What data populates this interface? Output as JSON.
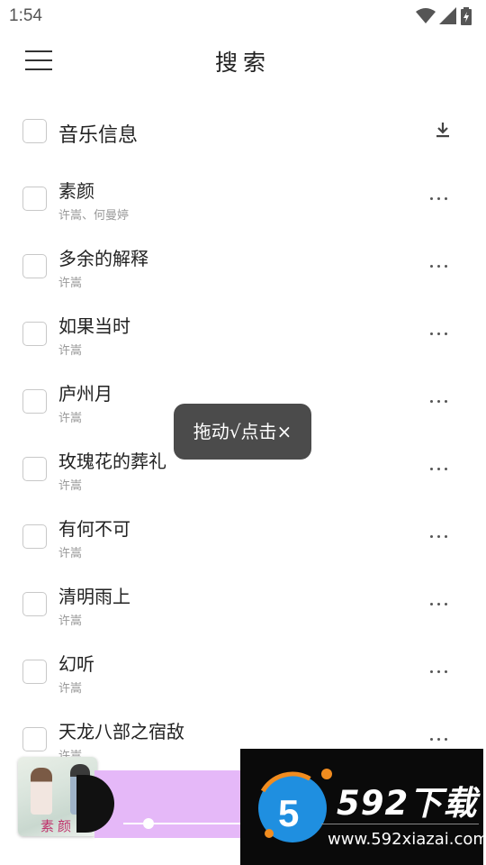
{
  "status_bar": {
    "time": "1:54",
    "icons": [
      "wifi-icon",
      "signal-icon",
      "battery-charging-icon"
    ]
  },
  "app_bar": {
    "title": "搜索",
    "menu_icon": "hamburger-menu-icon"
  },
  "header": {
    "label": "音乐信息",
    "download_icon": "download-icon"
  },
  "songs": [
    {
      "name": "素颜",
      "artist": "许嵩、何曼婷"
    },
    {
      "name": "多余的解释",
      "artist": "许嵩"
    },
    {
      "name": "如果当时",
      "artist": "许嵩"
    },
    {
      "name": "庐州月",
      "artist": "许嵩"
    },
    {
      "name": "玫瑰花的葬礼",
      "artist": "许嵩"
    },
    {
      "name": "有何不可",
      "artist": "许嵩"
    },
    {
      "name": "清明雨上",
      "artist": "许嵩"
    },
    {
      "name": "幻听",
      "artist": "许嵩"
    },
    {
      "name": "天龙八部之宿敌",
      "artist": "许嵩"
    }
  ],
  "toast": {
    "text": "拖动√点击×"
  },
  "player": {
    "album_text": "素颜",
    "progress": 0.2
  },
  "watermark": {
    "brand": "592下载",
    "url": "www.592xiazai.com",
    "logo_digit": "5"
  },
  "colors": {
    "player_bg": "#e5b8f8",
    "toast_bg": "#4b4b4b",
    "watermark_logo": "#1f8fe0"
  }
}
